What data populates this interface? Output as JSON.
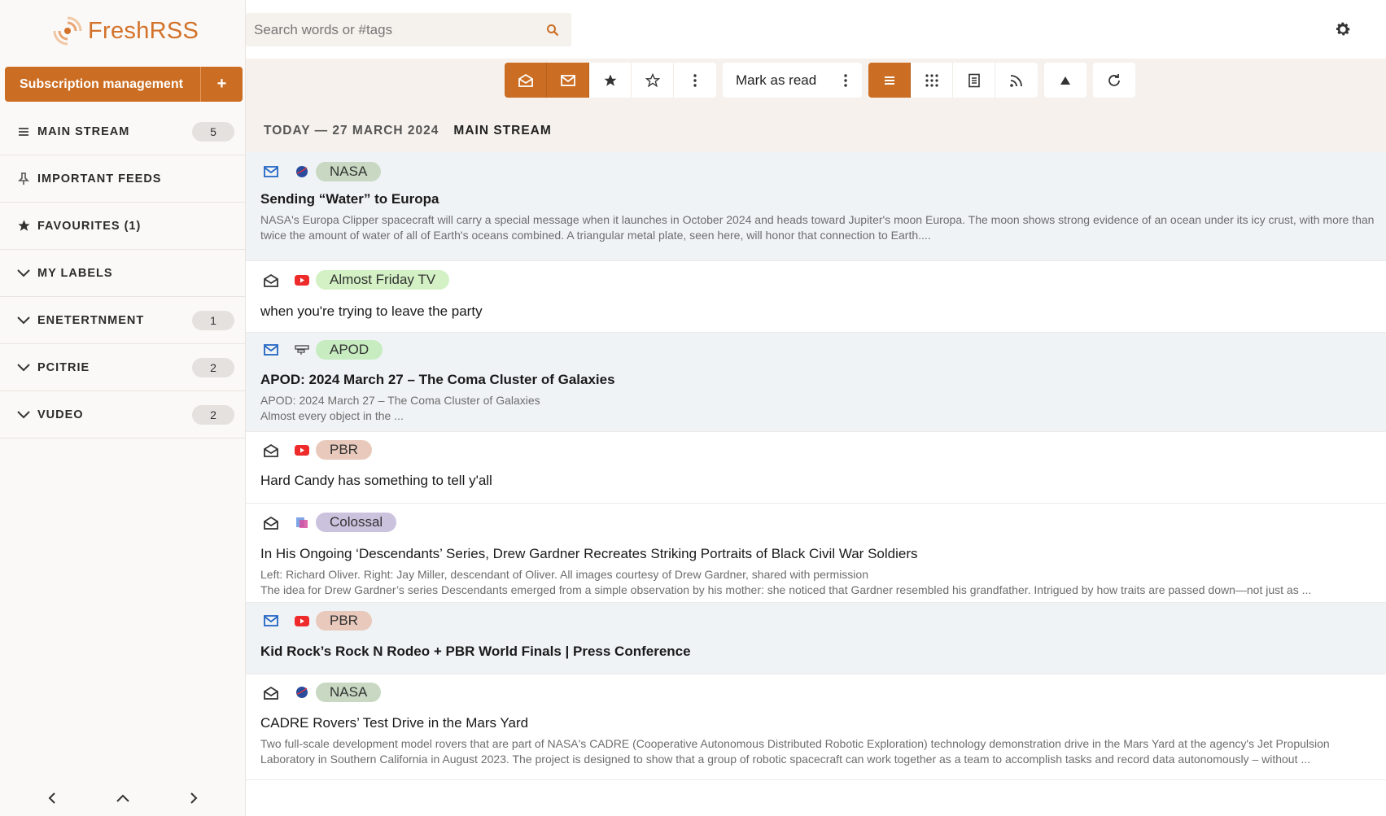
{
  "app": {
    "name": "FreshRSS"
  },
  "search": {
    "placeholder": "Search words or #tags"
  },
  "sidebar": {
    "subscription_label": "Subscription management",
    "add_label": "+",
    "items": [
      {
        "icon": "list-icon",
        "label": "MAIN STREAM",
        "count": "5"
      },
      {
        "icon": "pin-icon",
        "label": "IMPORTANT FEEDS",
        "count": ""
      },
      {
        "icon": "star-icon",
        "label": "FAVOURITES (1)",
        "count": ""
      },
      {
        "icon": "chevron-down-icon",
        "label": "MY LABELS",
        "count": ""
      },
      {
        "icon": "chevron-down-icon",
        "label": "ENETERTNMENT",
        "count": "1"
      },
      {
        "icon": "chevron-down-icon",
        "label": "PCITRIE",
        "count": "2"
      },
      {
        "icon": "chevron-down-icon",
        "label": "VUDEO",
        "count": "2"
      }
    ]
  },
  "toolbar": {
    "mark_as_read": "Mark as read"
  },
  "stream": {
    "date": "TODAY — 27 MARCH 2024",
    "name": "MAIN STREAM"
  },
  "articles": [
    {
      "unread": true,
      "feed": "NASA",
      "feed_icon": "nasa-logo-icon",
      "tag_color": "#c8d8c2",
      "title": "Sending “Water” to Europa",
      "summary": "NASA's Europa Clipper spacecraft will carry a special message when it launches in October 2024 and heads toward Jupiter's moon Europa. The moon shows strong evidence of an ocean under its icy crust, with more than twice the amount of water of all of Earth's oceans combined. A triangular metal plate, seen here, will honor that connection to Earth....",
      "summary2": ""
    },
    {
      "unread": false,
      "feed": "Almost Friday TV",
      "feed_icon": "youtube-icon",
      "tag_color": "#d3f1c4",
      "title": "when you're trying to leave the party",
      "summary": "",
      "summary2": ""
    },
    {
      "unread": true,
      "feed": "APOD",
      "feed_icon": "apod-logo-icon",
      "tag_color": "#c7ecc0",
      "title": "APOD: 2024 March 27 – The Coma Cluster of Galaxies",
      "summary": "APOD: 2024 March 27 – The Coma Cluster of Galaxies",
      "summary2": "Almost every object in the ..."
    },
    {
      "unread": false,
      "feed": "PBR",
      "feed_icon": "youtube-icon",
      "tag_color": "#e8c9bb",
      "title": "Hard Candy has something to tell y'all",
      "summary": "",
      "summary2": ""
    },
    {
      "unread": false,
      "feed": "Colossal",
      "feed_icon": "colossal-logo-icon",
      "tag_color": "#cbc3de",
      "title": "In His Ongoing ‘Descendants’ Series, Drew Gardner Recreates Striking Portraits of Black Civil War Soldiers",
      "summary": "Left: Richard Oliver. Right: Jay Miller, descendant of Oliver. All images courtesy of Drew Gardner, shared with permission",
      "summary2": "The idea for Drew Gardner’s series Descendants emerged from a simple observation by his mother: she noticed that Gardner resembled his grandfather. Intrigued by how traits are passed down—not just as ..."
    },
    {
      "unread": true,
      "feed": "PBR",
      "feed_icon": "youtube-icon",
      "tag_color": "#e8c9bb",
      "title": "Kid Rock’s Rock N Rodeo + PBR World Finals | Press Conference",
      "summary": "",
      "summary2": ""
    },
    {
      "unread": false,
      "feed": "NASA",
      "feed_icon": "nasa-logo-icon",
      "tag_color": "#c8d8c2",
      "title": "CADRE Rovers’ Test Drive in the Mars Yard",
      "summary": "Two full-scale development model rovers that are part of NASA's CADRE (Cooperative Autonomous Distributed Robotic Exploration) technology demonstration drive in the Mars Yard at the agency's Jet Propulsion Laboratory in Southern California in August 2023. The project is designed to show that a group of robotic spacecraft can work together as a team to accomplish tasks and record data autonomously – without ...",
      "summary2": ""
    }
  ],
  "colors": {
    "accent": "#cb6d22",
    "unread_bg": "#f0f3f6",
    "sidebar_bg": "#fbf9f7"
  }
}
